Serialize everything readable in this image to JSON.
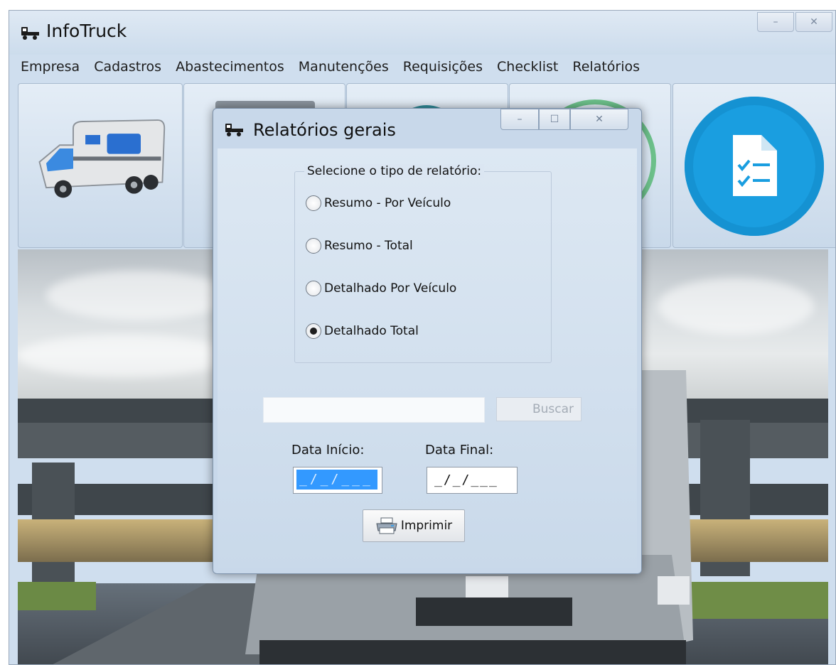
{
  "app": {
    "title": "InfoTruck"
  },
  "window_controls": {
    "minimize": "–",
    "close": "✕"
  },
  "menu": [
    "Empresa",
    "Cadastros",
    "Abastecimentos",
    "Manutenções",
    "Requisições",
    "Checklist",
    "Relatórios"
  ],
  "dialog": {
    "title": "Relatórios gerais",
    "controls": {
      "minimize": "–",
      "maximize": "☐",
      "close": "✕"
    },
    "group_label": "Selecione o tipo de relatório:",
    "options": [
      {
        "label": "Resumo - Por Veículo",
        "selected": false
      },
      {
        "label": "Resumo - Total",
        "selected": false
      },
      {
        "label": "Detalhado Por Veículo",
        "selected": false
      },
      {
        "label": "Detalhado Total",
        "selected": true
      }
    ],
    "search": {
      "value": "",
      "button_label": "Buscar"
    },
    "date_start": {
      "label": "Data Início:",
      "value": "_/_/___"
    },
    "date_end": {
      "label": "Data Final:",
      "value": "_/_/___"
    },
    "print_label": "Imprimir"
  },
  "icons": {
    "app": "truck-icon",
    "tile_1": "motorhome-icon",
    "tile_5": "checklist-document-icon",
    "print": "printer-icon"
  },
  "colors": {
    "accent_blue": "#1a9ee0",
    "selection_blue": "#3399ff",
    "ring_green": "#6cc08a"
  }
}
